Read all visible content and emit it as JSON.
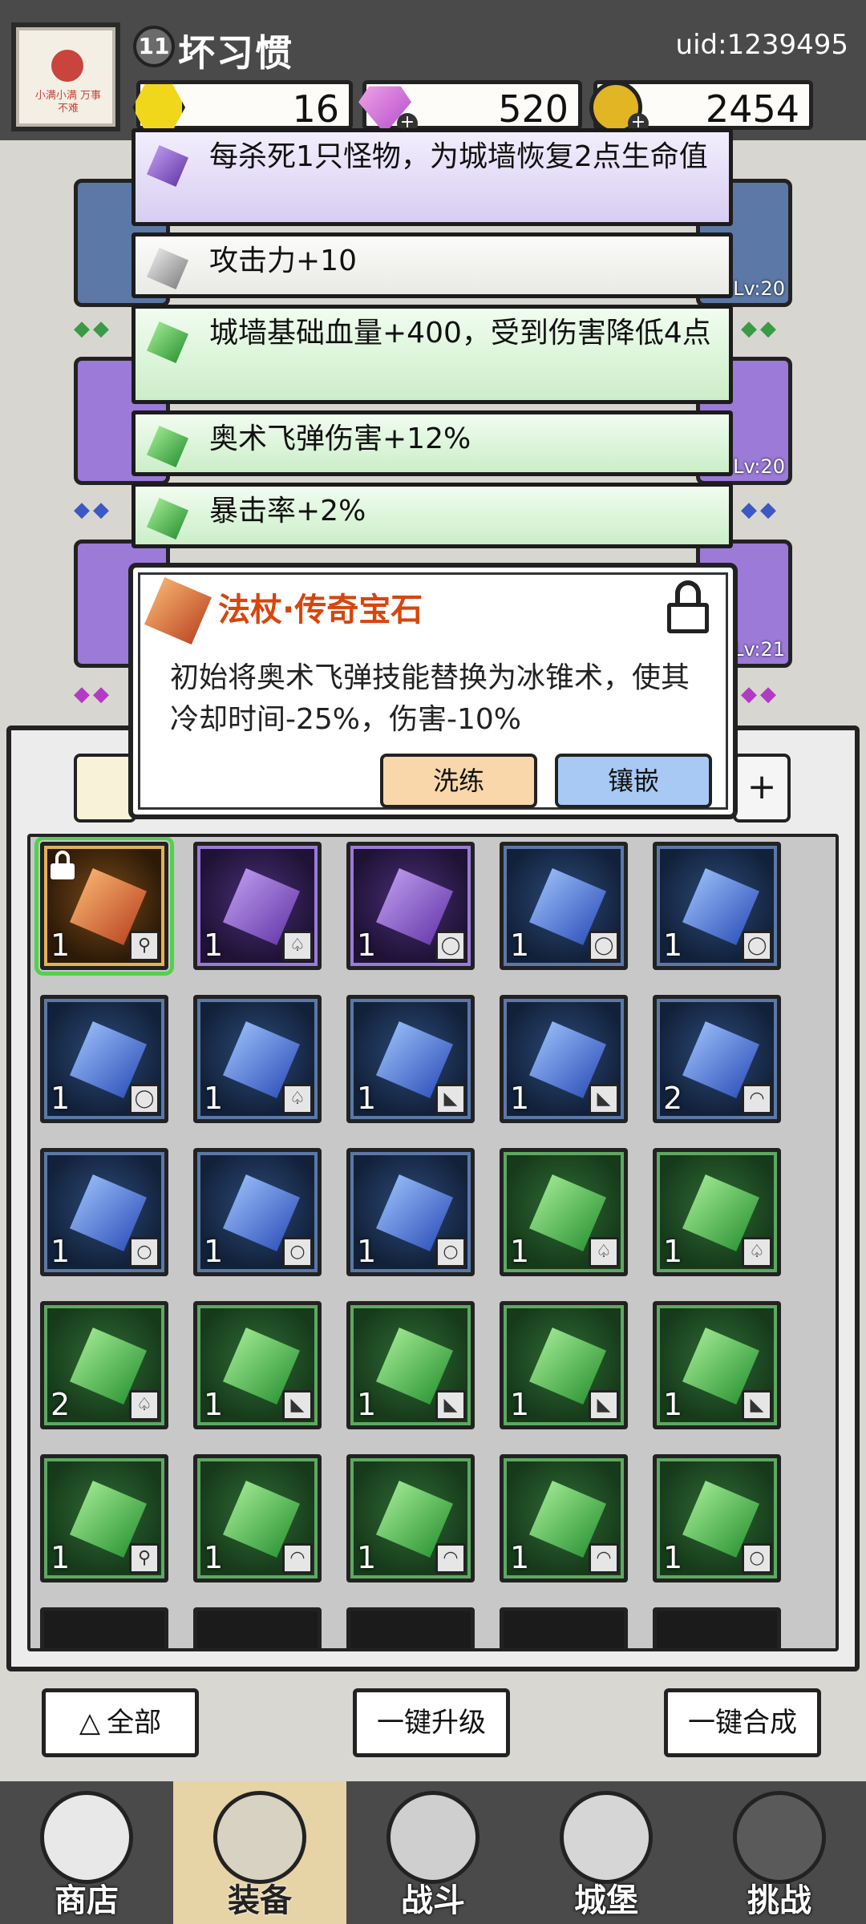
{
  "player": {
    "level": "11",
    "name": "坏习惯",
    "uid": "uid:1239495",
    "avatar_text": "小满小满 万事不难"
  },
  "resources": [
    {
      "name": "energy",
      "icon": "yellow-hex-icon",
      "value": "16"
    },
    {
      "name": "diamonds",
      "icon": "diamond-icon",
      "value": "520"
    },
    {
      "name": "gold",
      "icon": "gold-coin-icon",
      "value": "2454"
    }
  ],
  "equipment_levels": [
    "Lv:20",
    "Lv:20",
    "Lv:21"
  ],
  "tooltips": [
    {
      "quality": "purple",
      "text": "每杀死1只怪物，为城墙恢复2点生命值"
    },
    {
      "quality": "white",
      "text": "攻击力+10"
    },
    {
      "quality": "green",
      "text": "城墙基础血量+400，受到伤害降低4点"
    },
    {
      "quality": "green",
      "text": "奥术飞弹伤害+12%"
    },
    {
      "quality": "green",
      "text": "暴击率+2%"
    }
  ],
  "popup": {
    "title": "法杖·传奇宝石",
    "description": "初始将奥术飞弹技能替换为冰锥术，使其冷却时间-25%，伤害-10%",
    "refine_label": "洗练",
    "inlay_label": "镶嵌"
  },
  "inventory": {
    "add_tab_label": "+",
    "rows": [
      [
        {
          "color": "orange",
          "count": "1",
          "type": "staff",
          "locked": true,
          "selected": true
        },
        {
          "color": "purple",
          "count": "1",
          "type": "armor"
        },
        {
          "color": "purple",
          "count": "1",
          "type": "ring"
        },
        {
          "color": "blue",
          "count": "1",
          "type": "ring"
        },
        {
          "color": "blue",
          "count": "1",
          "type": "ring"
        }
      ],
      [
        {
          "color": "blue",
          "count": "1",
          "type": "ring"
        },
        {
          "color": "blue",
          "count": "1",
          "type": "armor"
        },
        {
          "color": "blue",
          "count": "1",
          "type": "boots"
        },
        {
          "color": "blue",
          "count": "1",
          "type": "boots"
        },
        {
          "color": "blue",
          "count": "2",
          "type": "hat"
        }
      ],
      [
        {
          "color": "blue",
          "count": "1",
          "type": "amulet"
        },
        {
          "color": "blue",
          "count": "1",
          "type": "amulet"
        },
        {
          "color": "blue",
          "count": "1",
          "type": "amulet"
        },
        {
          "color": "green",
          "count": "1",
          "type": "armor"
        },
        {
          "color": "green",
          "count": "1",
          "type": "armor"
        }
      ],
      [
        {
          "color": "green",
          "count": "2",
          "type": "armor"
        },
        {
          "color": "green",
          "count": "1",
          "type": "boots"
        },
        {
          "color": "green",
          "count": "1",
          "type": "boots"
        },
        {
          "color": "green",
          "count": "1",
          "type": "boots"
        },
        {
          "color": "green",
          "count": "1",
          "type": "boots"
        }
      ],
      [
        {
          "color": "green",
          "count": "1",
          "type": "staff"
        },
        {
          "color": "green",
          "count": "1",
          "type": "hat"
        },
        {
          "color": "green",
          "count": "1",
          "type": "hat"
        },
        {
          "color": "green",
          "count": "1",
          "type": "hat"
        },
        {
          "color": "green",
          "count": "1",
          "type": "amulet"
        }
      ]
    ]
  },
  "actions": {
    "all_label": "全部",
    "upgrade_label": "一键升级",
    "merge_label": "一键合成"
  },
  "nav": [
    {
      "label": "商店",
      "icon": "shop-hut-icon"
    },
    {
      "label": "装备",
      "icon": "backpack-icon",
      "active": true
    },
    {
      "label": "战斗",
      "icon": "crossed-swords-icon"
    },
    {
      "label": "城堡",
      "icon": "castle-icon"
    },
    {
      "label": "挑战",
      "icon": "locked-shield-icon"
    }
  ],
  "colors": {
    "legendary": "#d8450d",
    "purple": "#9b7ad8",
    "blue": "#5b78a6",
    "green": "#5ea862",
    "selected_outline": "#52d14a"
  }
}
